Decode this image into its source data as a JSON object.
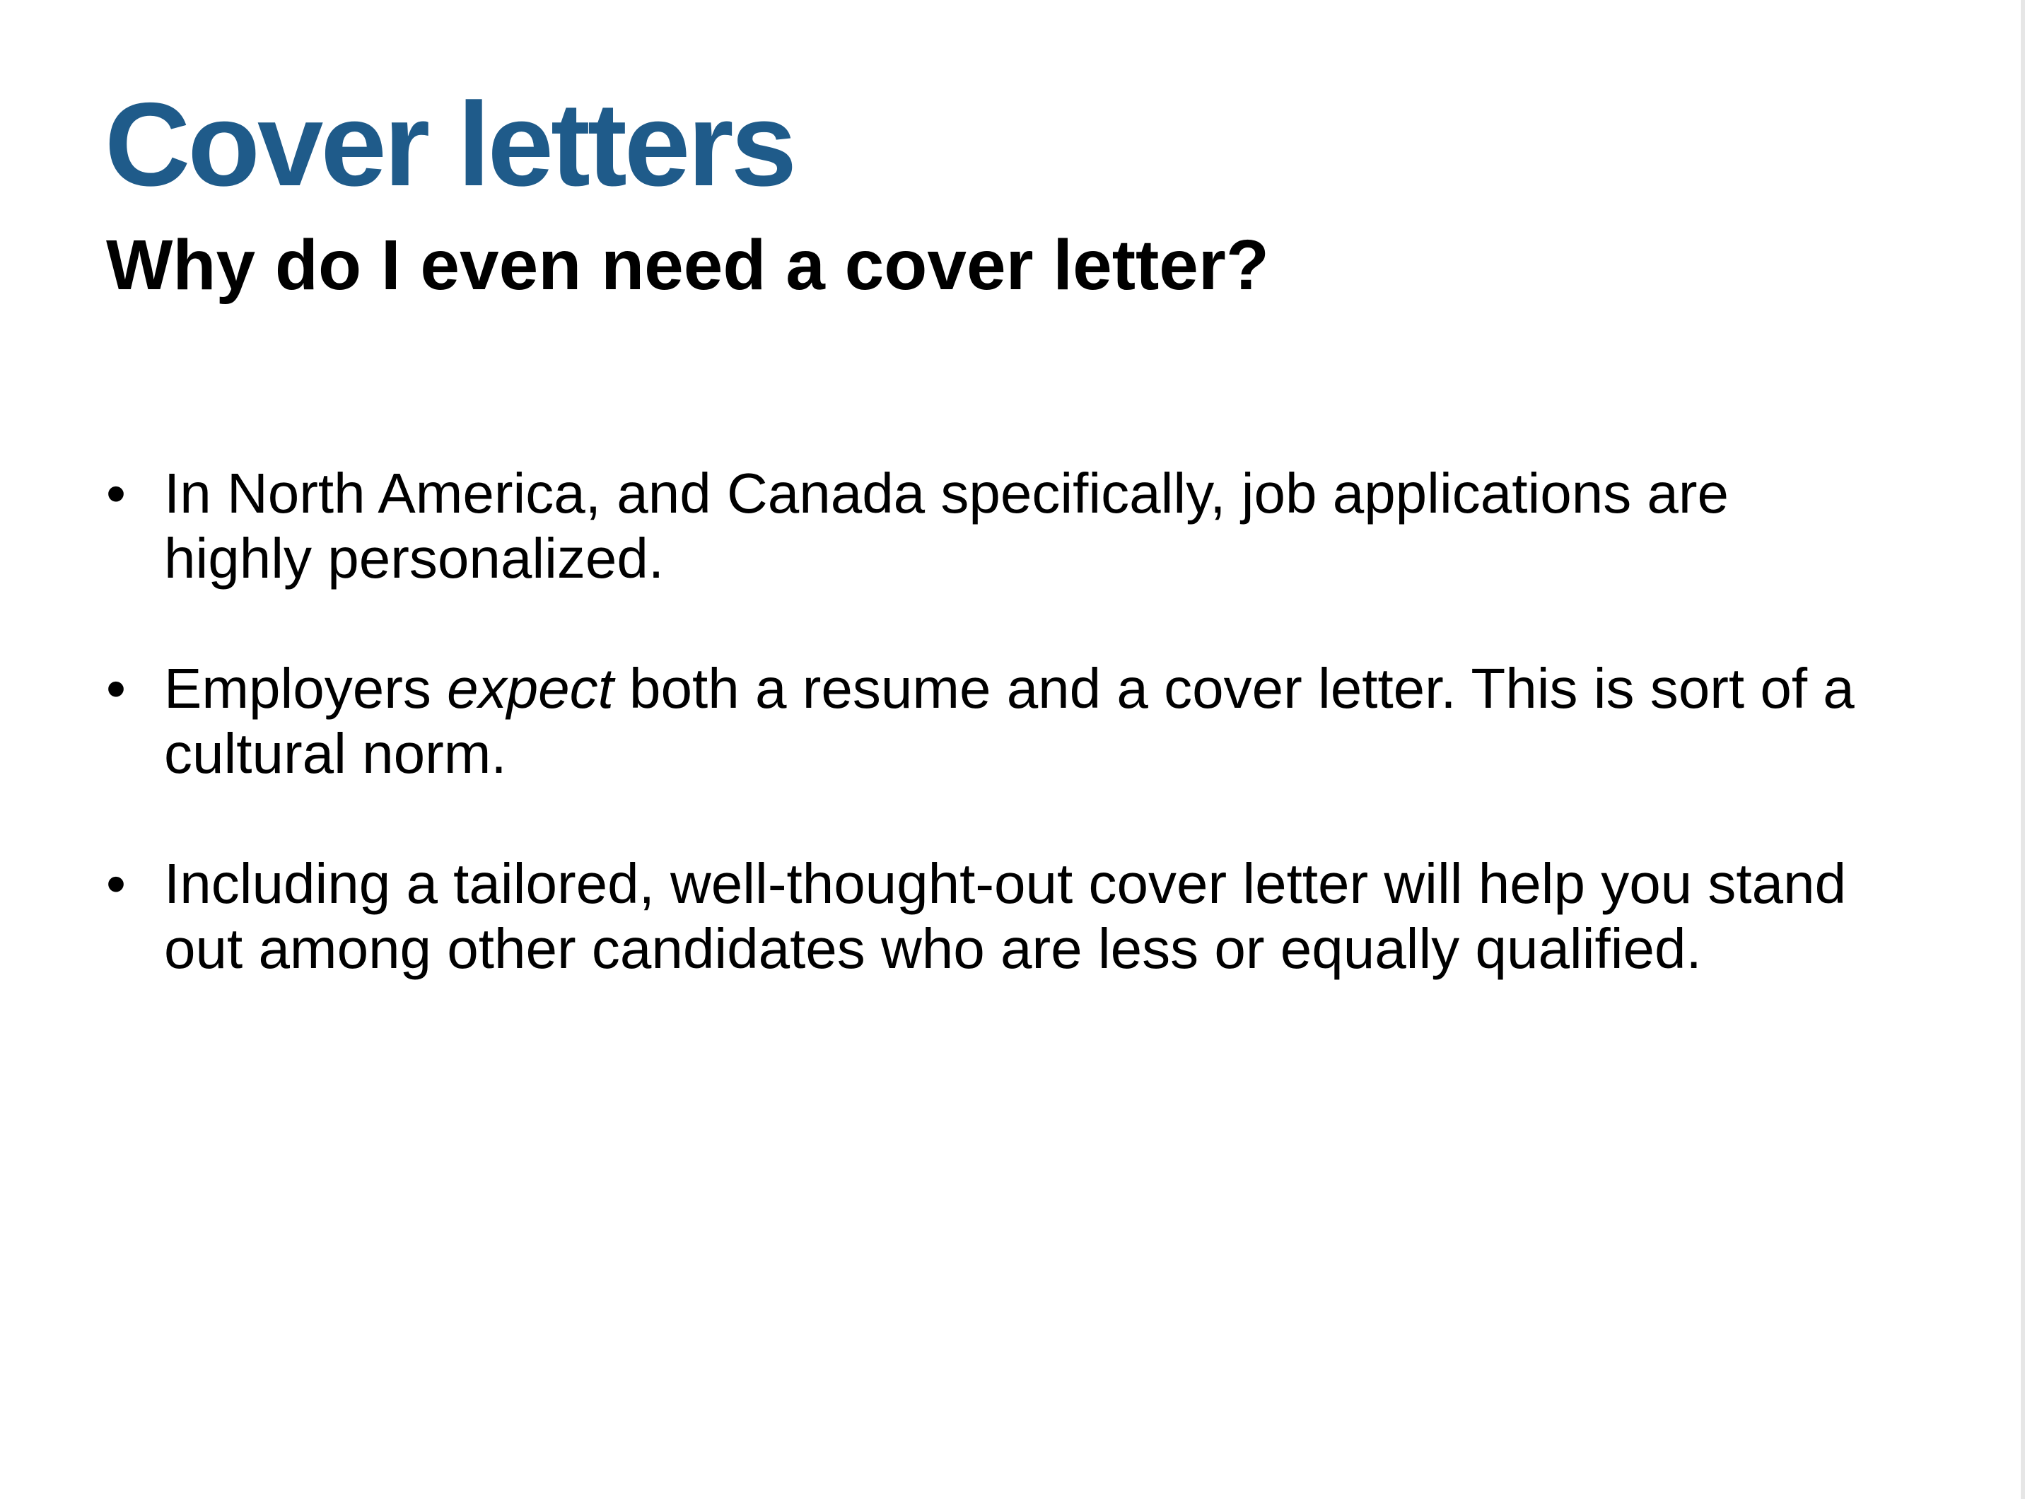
{
  "slide": {
    "title": "Cover letters",
    "subtitle": "Why do I even need a cover letter?",
    "colors": {
      "title": "#1f5b8a",
      "text": "#000000",
      "background": "#ffffff"
    },
    "bullet_glyph": "•",
    "bullets": [
      {
        "text": "In North America, and Canada specifically, job applications are highly personalized."
      },
      {
        "before": "Employers ",
        "emphasis": "expect",
        "after": " both a resume and a cover letter. This is sort of a cultural norm."
      },
      {
        "text": "Including a tailored, well-thought-out cover letter will help you stand out among other candidates who are less or equally qualified."
      }
    ]
  }
}
